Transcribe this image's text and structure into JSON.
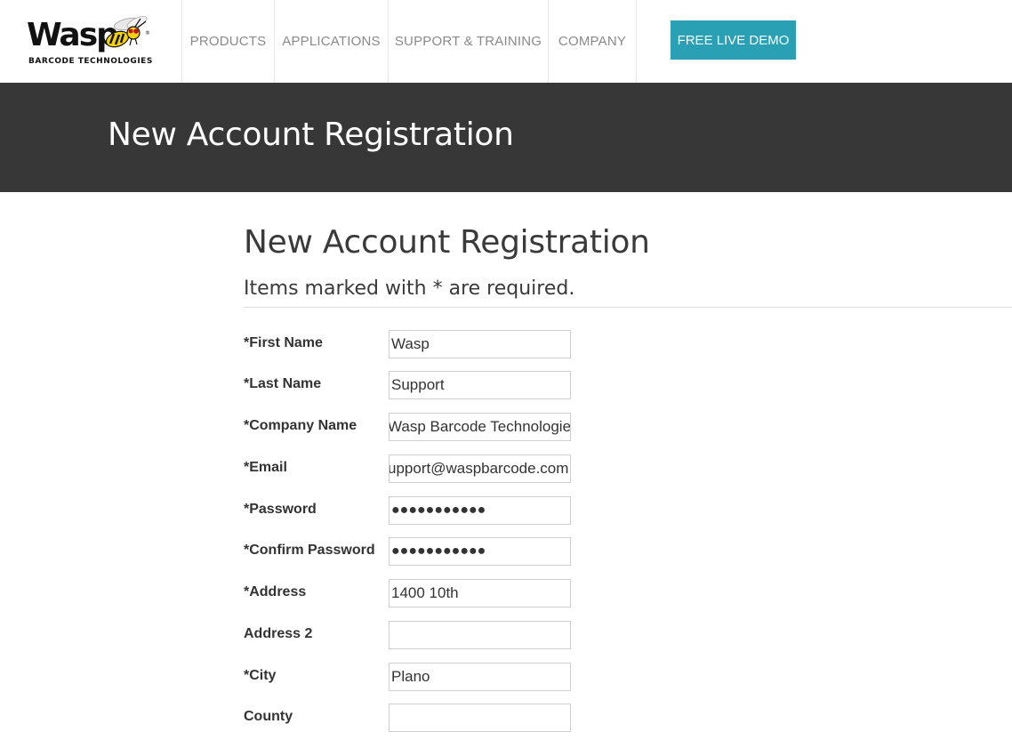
{
  "header": {
    "logo": {
      "word": "Wasp",
      "subtitle": "BARCODE TECHNOLOGIES",
      "icon": "wasp-icon"
    },
    "nav": [
      {
        "label": "PRODUCTS"
      },
      {
        "label": "APPLICATIONS"
      },
      {
        "label": "SUPPORT & TRAINING"
      },
      {
        "label": "COMPANY"
      }
    ],
    "cta_label": "FREE LIVE DEMO"
  },
  "banner": {
    "title": "New Account Registration"
  },
  "form": {
    "heading": "New Account Registration",
    "required_note": "Items marked with * are required.",
    "fields": [
      {
        "label": "*First Name",
        "value": "Wasp"
      },
      {
        "label": "*Last Name",
        "value": "Support"
      },
      {
        "label": "*Company Name",
        "value": "Wasp Barcode Technologies"
      },
      {
        "label": "*Email",
        "value": "upport@waspbarcode.com"
      },
      {
        "label": "*Password",
        "value": "●●●●●●●●●●●"
      },
      {
        "label": "*Confirm Password",
        "value": "●●●●●●●●●●●"
      },
      {
        "label": "*Address",
        "value": "1400 10th"
      },
      {
        "label": "Address 2",
        "value": ""
      },
      {
        "label": "*City",
        "value": "Plano"
      },
      {
        "label": "County",
        "value": ""
      }
    ]
  },
  "colors": {
    "banner_bg": "#373737",
    "cta_bg": "#2aa0b4",
    "nav_text": "#8a8a8a",
    "logo_yellow": "#f5d20a"
  }
}
